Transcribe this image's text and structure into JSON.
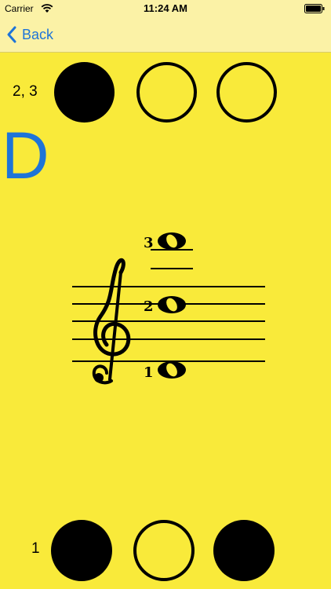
{
  "status_bar": {
    "carrier": "Carrier",
    "time": "11:24 AM",
    "wifi_icon": "wifi-icon",
    "battery_icon": "battery-icon"
  },
  "nav": {
    "back_label": "Back",
    "back_icon": "chevron-left-icon"
  },
  "top_fingering": {
    "label": "2, 3",
    "valves": [
      true,
      false,
      false
    ]
  },
  "note_name": "D",
  "staff": {
    "clef": "treble-clef-icon",
    "notes": [
      {
        "number": "3"
      },
      {
        "number": "2"
      },
      {
        "number": "1"
      }
    ]
  },
  "bottom_fingering": {
    "label": "1",
    "valves": [
      true,
      false,
      true
    ]
  },
  "colors": {
    "background": "#f9ea3a",
    "bar": "#fbf2a6",
    "accent": "#1e74d8",
    "ink": "#000000"
  }
}
